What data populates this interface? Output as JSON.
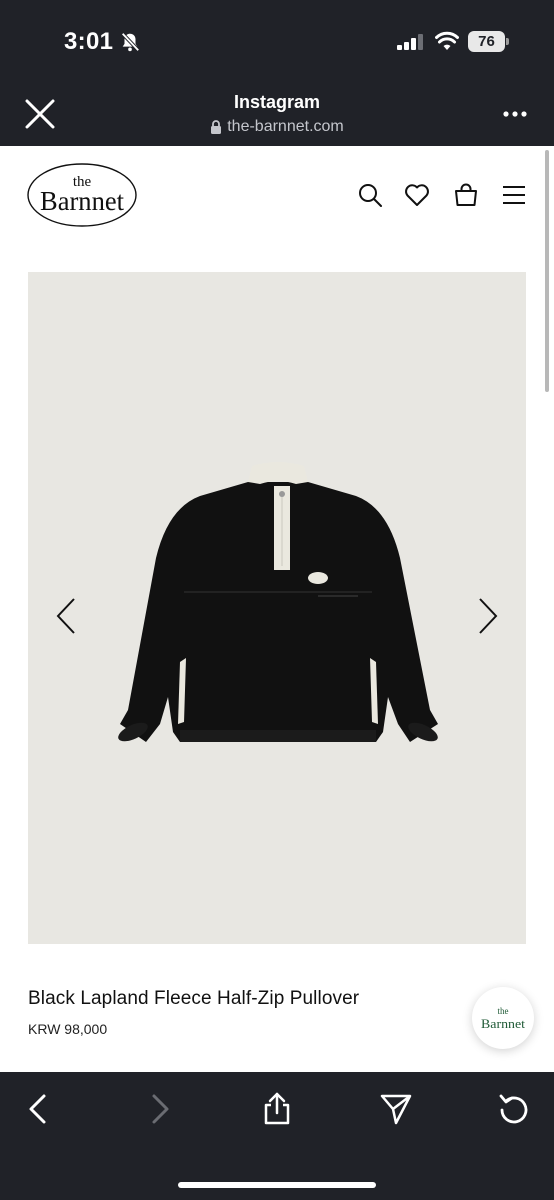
{
  "status_bar": {
    "time": "3:01",
    "battery": "76",
    "icons": [
      "bell-slash-icon",
      "signal-icon",
      "wifi-icon",
      "battery-icon"
    ]
  },
  "browser": {
    "title": "Instagram",
    "url": "the-barnnet.com",
    "icons": [
      "close-icon",
      "lock-icon",
      "more-icon"
    ]
  },
  "site": {
    "logo": {
      "top": "the",
      "bottom": "Barnnet"
    },
    "nav_icons": [
      "search-icon",
      "heart-icon",
      "bag-icon",
      "menu-icon"
    ]
  },
  "product": {
    "name": "Black Lapland Fleece Half-Zip Pullover",
    "price": "KRW 98,000",
    "image_background": "#e8e7e2",
    "garment_color": "#111111",
    "accent_color": "#eae8df"
  },
  "chat_badge": {
    "top": "the",
    "bottom": "Barnnet"
  },
  "toolbar": {
    "icons": [
      "back-icon",
      "forward-icon",
      "share-icon",
      "send-icon",
      "reload-icon"
    ],
    "forward_disabled": true
  }
}
